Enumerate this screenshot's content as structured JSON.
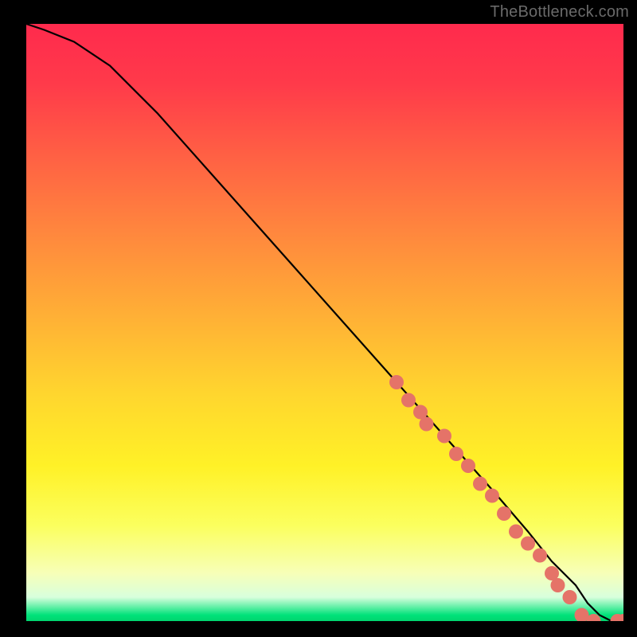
{
  "watermark": "TheBottleneck.com",
  "chart_data": {
    "type": "line",
    "title": "",
    "xlabel": "",
    "ylabel": "",
    "xlim": [
      0,
      100
    ],
    "ylim": [
      0,
      100
    ],
    "grid": false,
    "legend": false,
    "series": [
      {
        "name": "curve",
        "x": [
          0,
          3,
          8,
          14,
          22,
          30,
          38,
          46,
          54,
          62,
          70,
          78,
          84,
          88,
          92,
          94,
          96,
          98,
          100
        ],
        "y": [
          100,
          99,
          97,
          93,
          85,
          76,
          67,
          58,
          49,
          40,
          31,
          22,
          15,
          10,
          6,
          3,
          1,
          0,
          0
        ]
      }
    ],
    "markers": [
      {
        "x": 62,
        "y": 40
      },
      {
        "x": 64,
        "y": 37
      },
      {
        "x": 66,
        "y": 35
      },
      {
        "x": 67,
        "y": 33
      },
      {
        "x": 70,
        "y": 31
      },
      {
        "x": 72,
        "y": 28
      },
      {
        "x": 74,
        "y": 26
      },
      {
        "x": 76,
        "y": 23
      },
      {
        "x": 78,
        "y": 21
      },
      {
        "x": 80,
        "y": 18
      },
      {
        "x": 82,
        "y": 15
      },
      {
        "x": 84,
        "y": 13
      },
      {
        "x": 86,
        "y": 11
      },
      {
        "x": 88,
        "y": 8
      },
      {
        "x": 89,
        "y": 6
      },
      {
        "x": 91,
        "y": 4
      },
      {
        "x": 93,
        "y": 1
      },
      {
        "x": 95,
        "y": 0
      },
      {
        "x": 99,
        "y": 0
      },
      {
        "x": 100,
        "y": 0
      }
    ],
    "marker_style": {
      "color": "#e57368",
      "radius": 9
    }
  }
}
